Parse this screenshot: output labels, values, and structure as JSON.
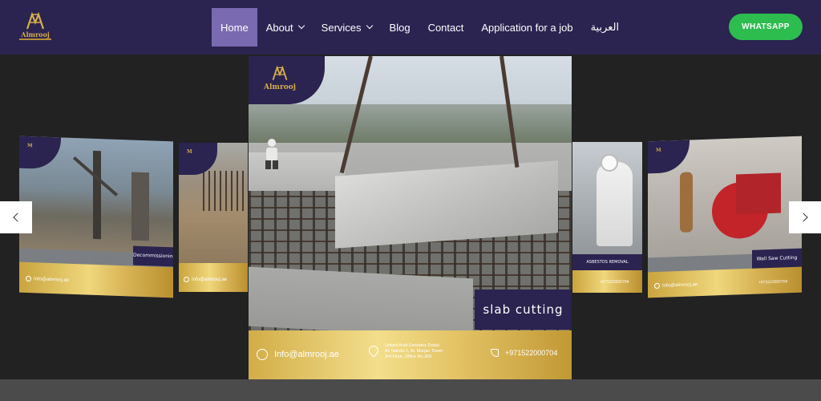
{
  "brand": {
    "name": "Almrooj",
    "gold": "#d4ad4a",
    "navy": "#2b2350",
    "accent": "#7a6ab1"
  },
  "nav": {
    "items": [
      {
        "label": "Home",
        "active": true,
        "dropdown": false
      },
      {
        "label": "About",
        "active": false,
        "dropdown": true
      },
      {
        "label": "Services",
        "active": false,
        "dropdown": true
      },
      {
        "label": "Blog",
        "active": false,
        "dropdown": false
      },
      {
        "label": "Contact",
        "active": false,
        "dropdown": false
      },
      {
        "label": "Application for a job",
        "active": false,
        "dropdown": false
      },
      {
        "label": "العربية",
        "active": false,
        "dropdown": false
      }
    ]
  },
  "header": {
    "whatsapp_label": "WHATSAPP",
    "whatsapp_color": "#2dbd4e"
  },
  "slider": {
    "main": {
      "label": "slab cutting",
      "email": "Info@almrooj.ae",
      "address": [
        "United Arab Emirates Dubai",
        "AL Nahda 2, AL Murjan Tower",
        "3rd Floor, Office No.305"
      ],
      "phone": "+971522000704"
    },
    "left_far": {
      "label": "Decommissioning",
      "email": "Info@almrooj.ae"
    },
    "left_near": {
      "email": "Info@almrooj.ae"
    },
    "right_near": {
      "label": "ASBESTOS REMOVAL",
      "phone": "+971522000704"
    },
    "right_far": {
      "label": "Wall Saw Cutting",
      "email": "Info@almrooj.ae",
      "phone": "+971522000704"
    },
    "prev_icon": "chevron-left-icon",
    "next_icon": "chevron-right-icon"
  }
}
